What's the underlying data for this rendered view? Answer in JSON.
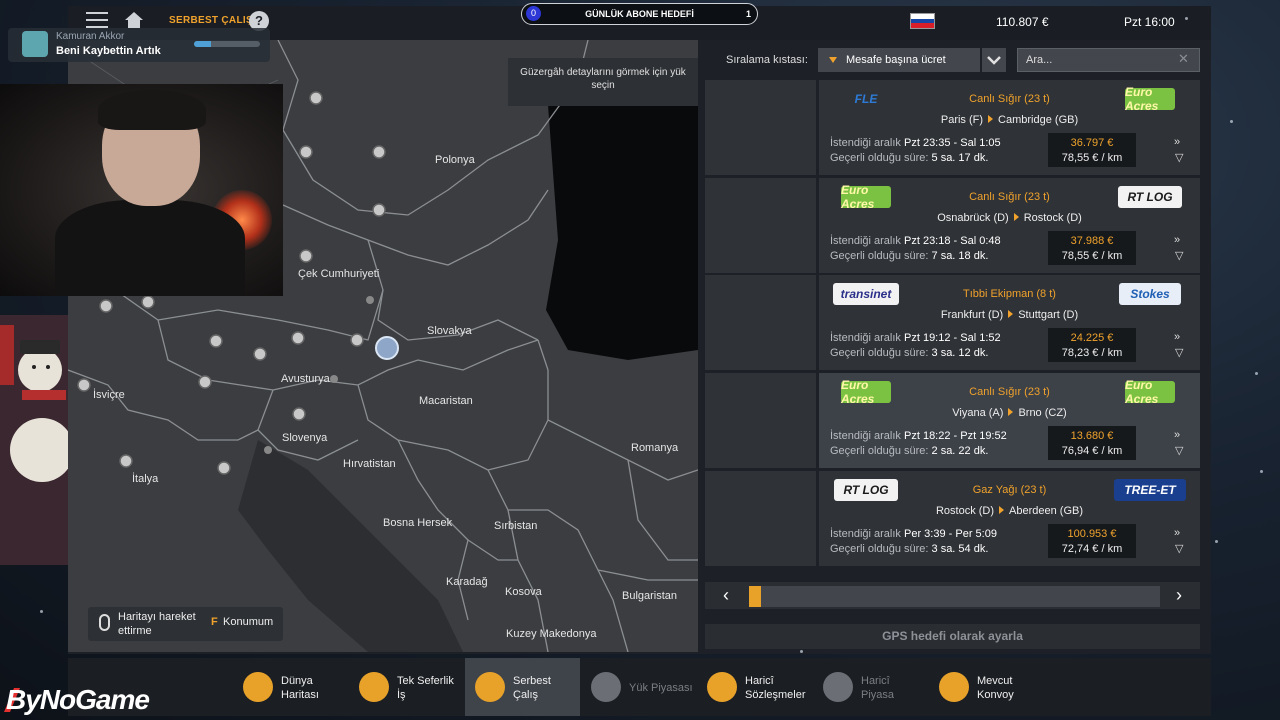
{
  "header": {
    "breadcrumb": "SERBEST ÇALIŞ",
    "help_icon": "?",
    "goal": {
      "title": "GÜNLÜK ABONE HEDEFİ",
      "current": "0",
      "target": "1"
    },
    "money": "110.807 €",
    "time": "Pzt 16:00"
  },
  "map": {
    "tooltip": "Güzergâh detaylarını görmek için yük seçin",
    "countries": [
      {
        "name": "Polonya"
      },
      {
        "name": "Çek Cumhuriyeti"
      },
      {
        "name": "Slovakya"
      },
      {
        "name": "Avusturya"
      },
      {
        "name": "İsviçre"
      },
      {
        "name": "Macaristan"
      },
      {
        "name": "Slovenya"
      },
      {
        "name": "Romanya"
      },
      {
        "name": "Hırvatistan"
      },
      {
        "name": "İtalya"
      },
      {
        "name": "Bosna Hersek"
      },
      {
        "name": "Sırbistan"
      },
      {
        "name": "Karadağ"
      },
      {
        "name": "Kosova"
      },
      {
        "name": "Bulgaristan"
      },
      {
        "name": "Kuzey Makedonya"
      }
    ],
    "move_hint": "Haritayı hareket ettirme",
    "location_key": "F",
    "location_label": "Konumum"
  },
  "sort": {
    "label": "Sıralama kıstası:",
    "value": "Mesafe başına ücret",
    "search_placeholder": "Ara..."
  },
  "jobs": [
    {
      "from_company": "FLE",
      "to_company": "Euro Acres",
      "cargo": "Canlı Sığır (23 t)",
      "from": "Paris (F)",
      "to": "Cambridge (GB)",
      "interval_label": "İstendiği aralık",
      "interval": "Pzt 23:35 - Sal 1:05",
      "validity_label": "Geçerli olduğu süre:",
      "validity": "5 sa. 17 dk.",
      "price": "36.797 €",
      "per_km": "78,55 € / km",
      "highlighted": false
    },
    {
      "from_company": "Euro Acres",
      "to_company": "RT LOG",
      "cargo": "Canlı Sığır (23 t)",
      "from": "Osnabrück (D)",
      "to": "Rostock (D)",
      "interval_label": "İstendiği aralık",
      "interval": "Pzt 23:18 - Sal 0:48",
      "validity_label": "Geçerli olduğu süre:",
      "validity": "7 sa. 18 dk.",
      "price": "37.988 €",
      "per_km": "78,55 € / km",
      "highlighted": false
    },
    {
      "from_company": "transinet",
      "to_company": "Stokes",
      "cargo": "Tıbbi Ekipman (8 t)",
      "from": "Frankfurt (D)",
      "to": "Stuttgart (D)",
      "interval_label": "İstendiği aralık",
      "interval": "Pzt 19:12 - Sal 1:52",
      "validity_label": "Geçerli olduğu süre:",
      "validity": "3 sa. 12 dk.",
      "price": "24.225 €",
      "per_km": "78,23 € / km",
      "highlighted": false
    },
    {
      "from_company": "Euro Acres",
      "to_company": "Euro Acres",
      "cargo": "Canlı Sığır (23 t)",
      "from": "Viyana (A)",
      "to": "Brno (CZ)",
      "interval_label": "İstendiği aralık",
      "interval": "Pzt 18:22 - Pzt 19:52",
      "validity_label": "Geçerli olduğu süre:",
      "validity": "2 sa. 22 dk.",
      "price": "13.680 €",
      "per_km": "76,94 € / km",
      "highlighted": true
    },
    {
      "from_company": "RT LOG",
      "to_company": "TREE-ET",
      "cargo": "Gaz Yağı (23 t)",
      "from": "Rostock (D)",
      "to": "Aberdeen (GB)",
      "interval_label": "İstendiği aralık",
      "interval": "Per 3:39 - Per 5:09",
      "validity_label": "Geçerli olduğu süre:",
      "validity": "3 sa. 54 dk.",
      "price": "100.953 €",
      "per_km": "72,74 € / km",
      "highlighted": false
    }
  ],
  "pager": {
    "current_page": 1,
    "total_pages": 35
  },
  "gps_button": "GPS hedefi olarak ayarla",
  "nav": [
    {
      "label_1": "Dünya",
      "label_2": "Haritası",
      "icon": "world-map-icon",
      "active": false,
      "enabled": true
    },
    {
      "label_1": "Tek Seferlik",
      "label_2": "İş",
      "icon": "clock-icon",
      "active": false,
      "enabled": true
    },
    {
      "label_1": "Serbest",
      "label_2": "Çalış",
      "icon": "free-work-icon",
      "active": true,
      "enabled": true
    },
    {
      "label_1": "Yük Piyasası",
      "label_2": "",
      "icon": "cargo-market-icon",
      "active": false,
      "enabled": false
    },
    {
      "label_1": "Haricî",
      "label_2": "Sözleşmeler",
      "icon": "external-contracts-icon",
      "active": false,
      "enabled": true
    },
    {
      "label_1": "Haricî",
      "label_2": "Piyasa",
      "icon": "external-market-icon",
      "active": false,
      "enabled": false
    },
    {
      "label_1": "Mevcut",
      "label_2": "Konvoy",
      "icon": "convoy-icon",
      "active": false,
      "enabled": true
    }
  ],
  "overlay": {
    "viewer_name": "Kamuran Akkor",
    "song": "Beni Kaybettin Artık",
    "song_progress": 0.25,
    "brand": "ByNoGame"
  },
  "colors": {
    "accent": "#f0a22c",
    "panel": "#2f3236",
    "panel_highlight": "#3d4148",
    "map": "#3b3d40"
  }
}
